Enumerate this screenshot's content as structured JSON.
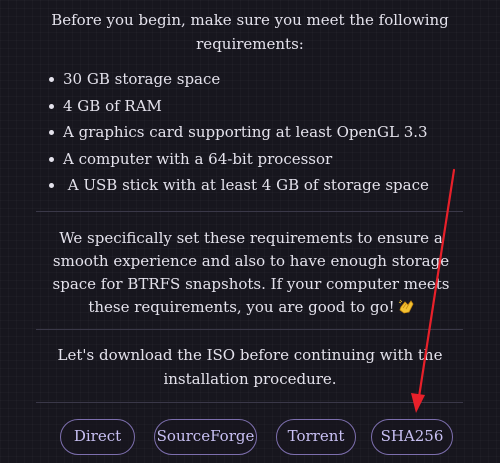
{
  "intro_text": "Before you begin, make sure you meet the following requirements:",
  "requirements": [
    "30 GB storage space",
    "4 GB of RAM",
    "A graphics card supporting at least OpenGL 3.3",
    "A computer with a 64-bit processor",
    " A USB stick with at least 4 GB of storage space"
  ],
  "paragraph": "We specifically set these requirements to ensure a smooth experience and also to have enough storage space for BTRFS snapshots. If your computer meets these requirements, you are good to go!",
  "emoji_icon": "clapping-hands-icon",
  "download_text": "Let's download the ISO before continuing with the installation procedure.",
  "buttons": {
    "direct": "Direct",
    "sourceforge": "SourceForge",
    "torrent": "Torrent",
    "sha256": "SHA256"
  },
  "colors": {
    "background": "#17161e",
    "text": "#e4e2ec",
    "button_border": "#7d6fae",
    "button_text": "#c8c0f3",
    "arrow": "#e8202a"
  }
}
